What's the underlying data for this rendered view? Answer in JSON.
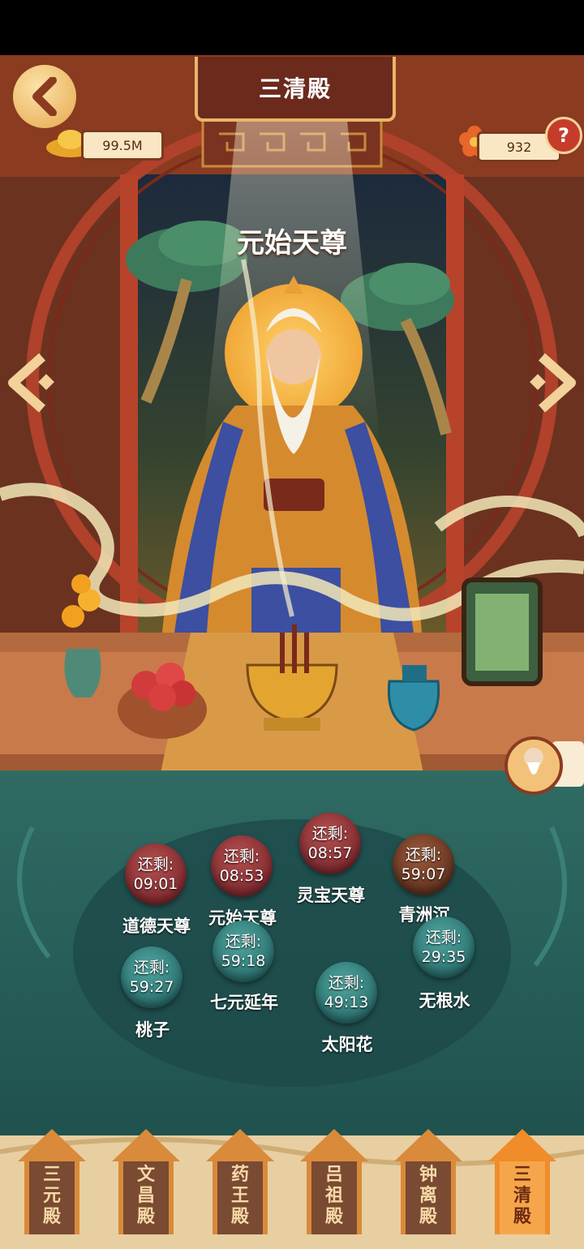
{
  "header": {
    "title": "三清殿"
  },
  "currency": {
    "gold": "99.5M",
    "flowers": "932",
    "help_label": "?"
  },
  "deity": {
    "name": "元始天尊"
  },
  "offerings": [
    {
      "remaining": "还剩:",
      "time": "09:01",
      "name": "道德天尊",
      "color": "red"
    },
    {
      "remaining": "还剩:",
      "time": "08:53",
      "name": "元始天尊",
      "color": "red"
    },
    {
      "remaining": "还剩:",
      "time": "08:57",
      "name": "灵宝天尊",
      "color": "red"
    },
    {
      "remaining": "还剩:",
      "time": "59:07",
      "name": "青洲沉",
      "color": "brown"
    },
    {
      "remaining": "还剩:",
      "time": "59:27",
      "name": "桃子",
      "color": "green"
    },
    {
      "remaining": "还剩:",
      "time": "59:18",
      "name": "七元延年",
      "color": "green"
    },
    {
      "remaining": "还剩:",
      "time": "49:13",
      "name": "太阳花",
      "color": "green"
    },
    {
      "remaining": "还剩:",
      "time": "29:35",
      "name": "无根水",
      "color": "green"
    }
  ],
  "tabs": [
    {
      "chars": [
        "三",
        "元",
        "殿"
      ],
      "active": false
    },
    {
      "chars": [
        "文",
        "昌",
        "殿"
      ],
      "active": false
    },
    {
      "chars": [
        "药",
        "王",
        "殿"
      ],
      "active": false
    },
    {
      "chars": [
        "吕",
        "祖",
        "殿"
      ],
      "active": false
    },
    {
      "chars": [
        "钟",
        "离",
        "殿"
      ],
      "active": false
    },
    {
      "chars": [
        "三",
        "清",
        "殿"
      ],
      "active": true
    }
  ],
  "colors": {
    "accent": "#e9b56b",
    "wood": "#8a3b20",
    "floor": "#215a56",
    "tab": "#7a4a32",
    "tab_active": "#f08c2a"
  }
}
